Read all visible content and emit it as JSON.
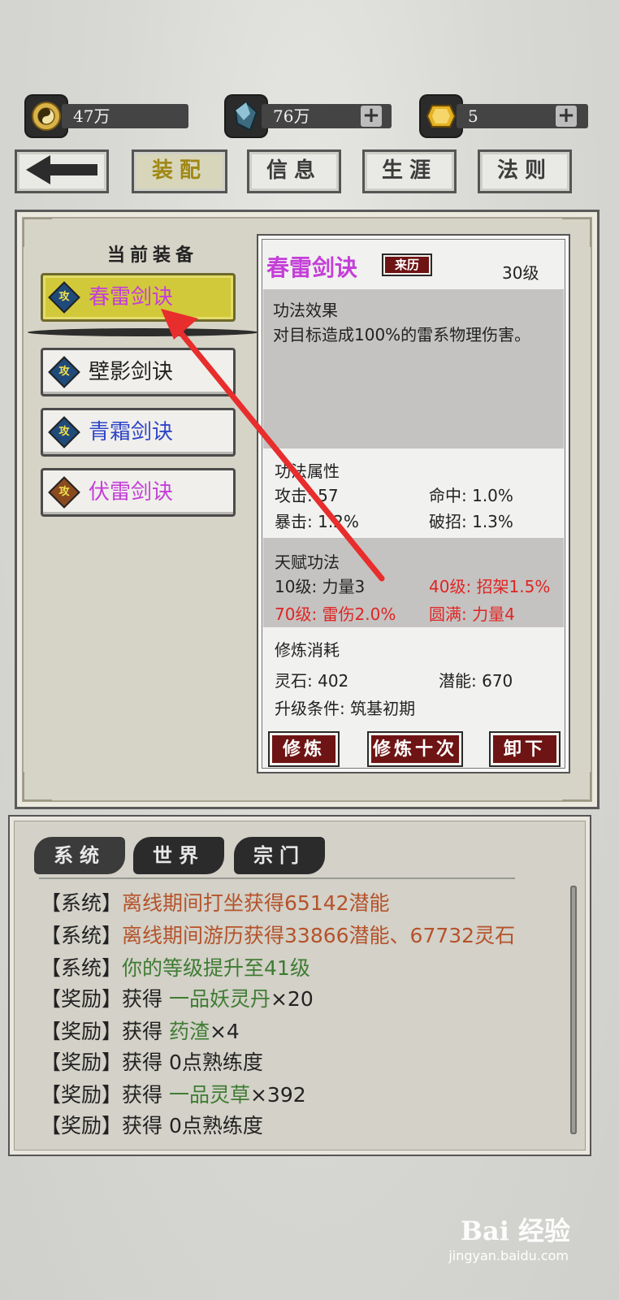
{
  "currency": {
    "tai_chi_amount": "47万",
    "crystal_amount": "76万",
    "gold_amount": "5"
  },
  "top_tabs": [
    {
      "label": "装配",
      "active": true
    },
    {
      "label": "信息"
    },
    {
      "label": "生涯"
    },
    {
      "label": "法则"
    }
  ],
  "equip_title": "当前装备",
  "skills": [
    {
      "icon_label": "攻",
      "name": "春雷剑诀",
      "color": "#c43fd8",
      "selected": true
    },
    {
      "icon_label": "攻",
      "name": "壁影剑诀",
      "color": "#222222"
    },
    {
      "icon_label": "攻",
      "name": "青霜剑诀",
      "color": "#2f45c8"
    },
    {
      "icon_label": "攻",
      "name": "伏雷剑诀",
      "color": "#c43fd8"
    }
  ],
  "detail": {
    "name": "春雷剑诀",
    "origin_button": "来历",
    "level": "30级",
    "effect_title": "功法效果",
    "effect_text": "对目标造成100%的雷系物理伤害。",
    "attr_title": "功法属性",
    "attack": "攻击: 57",
    "hit": "命中: 1.0%",
    "crit": "暴击: 1.2%",
    "break": "破招: 1.3%",
    "talent_title": "天赋功法",
    "talents": [
      {
        "text": "10级: 力量3",
        "color": "#222222"
      },
      {
        "text": "40级: 招架1.5%",
        "color": "#e02424"
      },
      {
        "text": "70级: 雷伤2.0%",
        "color": "#e02424"
      },
      {
        "text": "圆满: 力量4",
        "color": "#e02424"
      }
    ],
    "cost_title": "修炼消耗",
    "spirit_stone": "灵石: 402",
    "potential": "潜能: 670",
    "upgrade_condition": "升级条件: 筑基初期",
    "buttons": {
      "cultivate": "修炼",
      "cultivate_ten": "修炼十次",
      "unequip": "卸下"
    }
  },
  "chat": {
    "tabs": [
      "系统",
      "世界",
      "宗门"
    ],
    "messages": [
      {
        "tag": "【系统】",
        "prefix": "",
        "highlight": "离线期间打坐获得65142潜能",
        "suffix": "",
        "color": "orange"
      },
      {
        "tag": "【系统】",
        "prefix": "",
        "highlight": "离线期间游历获得33866潜能、67732灵石",
        "suffix": "",
        "color": "orange"
      },
      {
        "tag": "【系统】",
        "prefix": "",
        "highlight": "你的等级提升至41级",
        "suffix": "",
        "color": "green"
      },
      {
        "tag": "【奖励】",
        "prefix": "获得 ",
        "highlight": "一品妖灵丹",
        "suffix": "×20",
        "color": "green"
      },
      {
        "tag": "【奖励】",
        "prefix": "获得 ",
        "highlight": "药渣",
        "suffix": "×4",
        "color": "green"
      },
      {
        "tag": "【奖励】",
        "prefix": "获得 0点熟练度",
        "highlight": "",
        "suffix": "",
        "color": "green"
      },
      {
        "tag": "【奖励】",
        "prefix": "获得 ",
        "highlight": "一品灵草",
        "suffix": "×392",
        "color": "green"
      },
      {
        "tag": "【奖励】",
        "prefix": "获得 0点熟练度",
        "highlight": "",
        "suffix": "",
        "color": "green"
      }
    ]
  },
  "watermark": {
    "brand": "Bai 经验",
    "url": "jingyan.baidu.com"
  }
}
